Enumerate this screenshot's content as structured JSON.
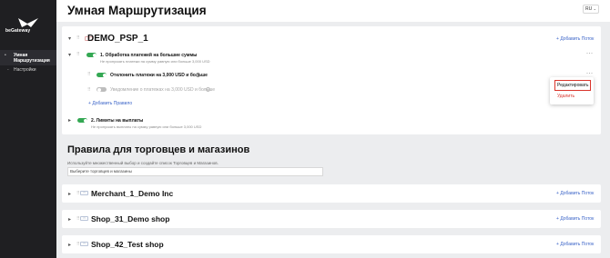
{
  "app": {
    "brand": "beGateway",
    "title": "Умная Маршрутизация",
    "lang": "RU"
  },
  "sidebar": {
    "items": [
      {
        "label_line1": "Умная",
        "label_line2": "Маршрутизация",
        "active": true
      },
      {
        "label": "Настройки",
        "active": false
      }
    ]
  },
  "psp": {
    "name": "DEMO_PSP_1",
    "add_label": "Добавить Поток",
    "rules": [
      {
        "title": "1. Обработка платежей на большие суммы",
        "desc": "Не пропускать платежи на сумму равную или больше 3,000 USD",
        "enabled": true,
        "actions": [
          {
            "text": "Отклонить платежи на 3,000 USD и больше",
            "enabled": true
          },
          {
            "text": "Уведомление о платежах на 3,000 USD и больше",
            "enabled": false
          }
        ],
        "add_rule_label": "Добавить Правило"
      },
      {
        "title": "2. Лимиты на выплаты",
        "desc": "Не пропускать выплаты на сумму равную или больше 3,000 USD",
        "enabled": true
      }
    ],
    "menu": {
      "edit": "Редактировать",
      "delete": "Удалить"
    }
  },
  "merchants_section": {
    "title": "Правила для торговцев и магазинов",
    "help": "Используйте множественный выбор и создайте список Торговцев и Магазинов.",
    "select_placeholder": "Выберите торговцев и магазины"
  },
  "merchants": [
    {
      "name": "Merchant_1_Demo Inc",
      "add_label": "Добавить Поток"
    },
    {
      "name": "Shop_31_Demo shop",
      "add_label": "Добавить Поток"
    },
    {
      "name": "Shop_42_Test shop",
      "add_label": "Добавить Поток"
    }
  ],
  "colors": {
    "accent_green": "#34a853",
    "link_blue": "#3b64c8",
    "danger_red": "#d9342b",
    "sidebar_bg": "#1f1f22"
  }
}
